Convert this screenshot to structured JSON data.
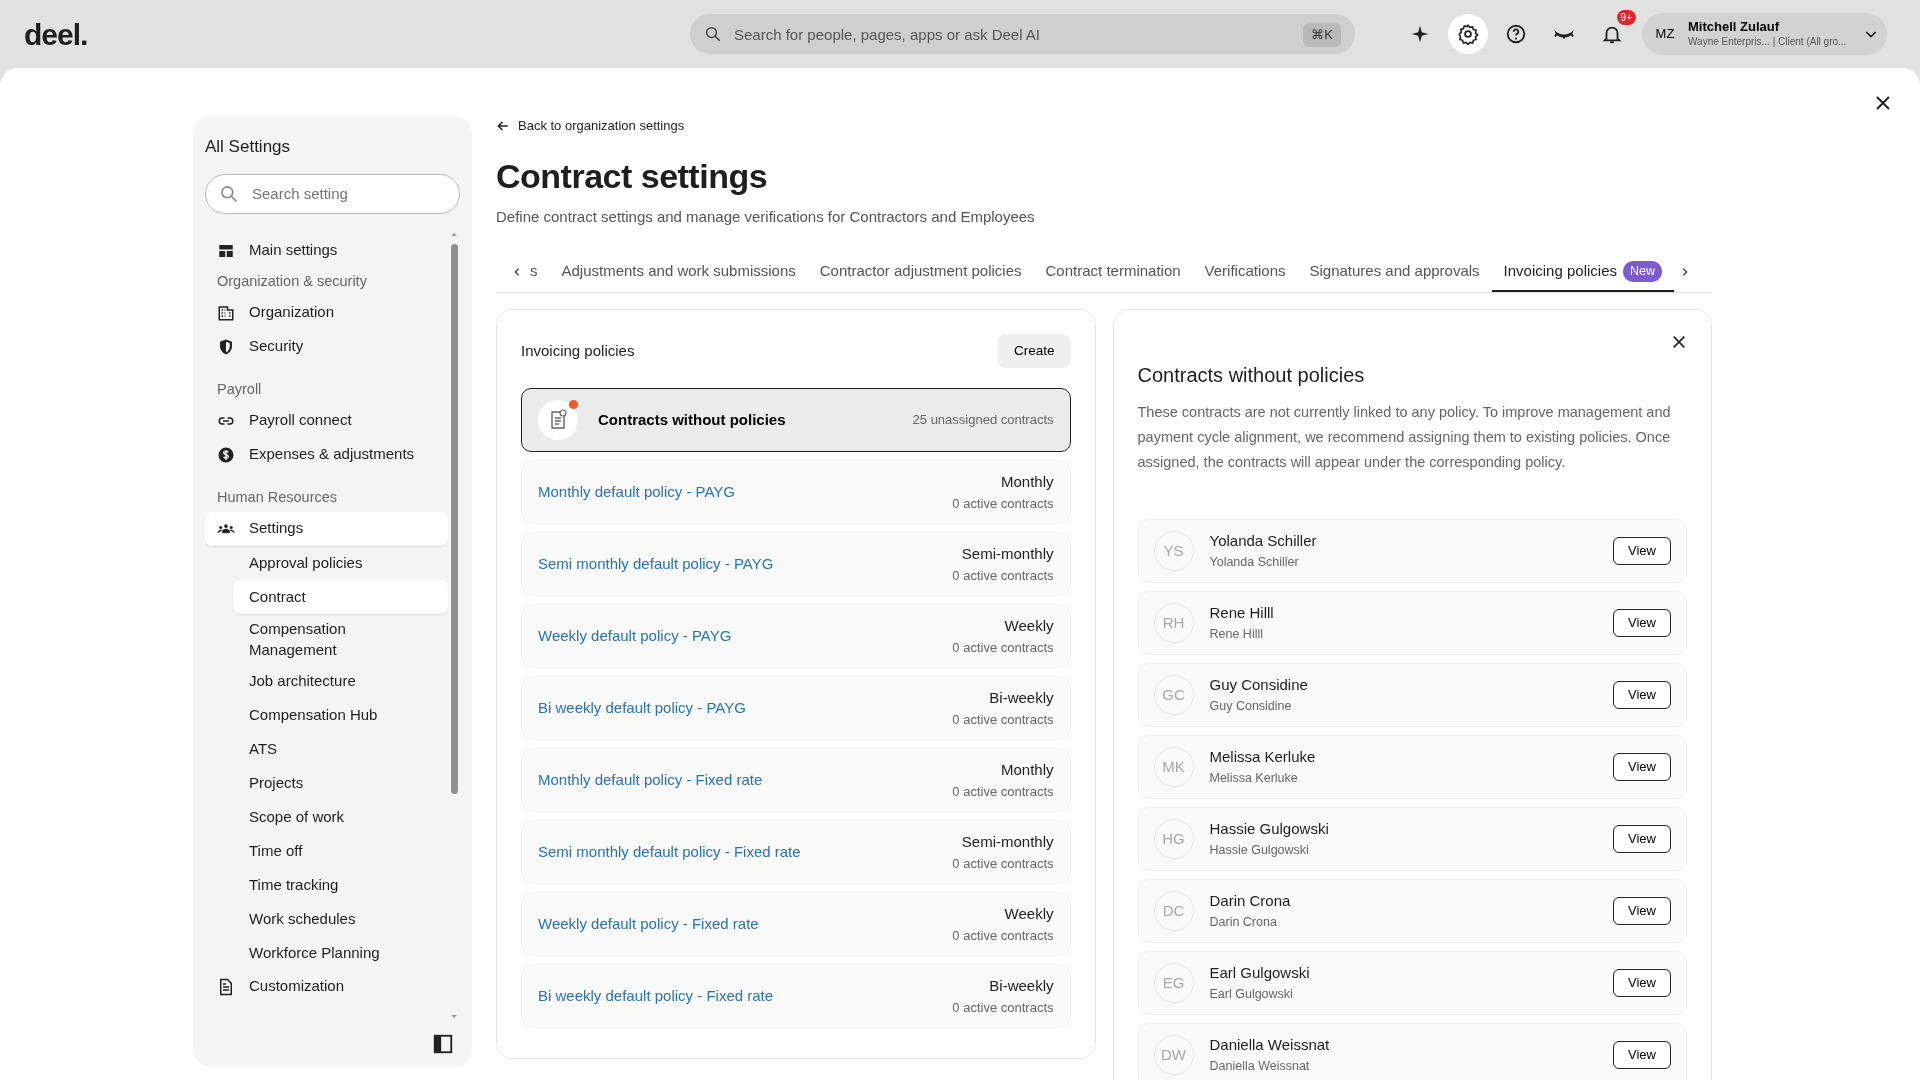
{
  "topbar": {
    "logo": "deel.",
    "search": {
      "placeholder": "Search for people, pages, apps or ask Deel AI",
      "shortcut": "⌘K"
    },
    "icon_buttons": [
      {
        "selected": false
      },
      {
        "selected": true
      },
      {
        "selected": false
      },
      {
        "selected": false
      },
      {
        "selected": false,
        "badge": "9+"
      }
    ],
    "user": {
      "initials": "MZ",
      "name": "Mitchell Zulauf",
      "detail": "Wayne Enterpris... | Client (All gro..."
    }
  },
  "sidebar": {
    "title": "All Settings",
    "search": {
      "placeholder": "Search setting"
    },
    "items": [
      {
        "kind": "link",
        "label": "Main settings",
        "selected": false
      },
      {
        "kind": "heading",
        "label": "Organization & security"
      },
      {
        "kind": "link",
        "label": "Organization",
        "selected": false
      },
      {
        "kind": "link",
        "label": "Security",
        "selected": false
      },
      {
        "kind": "heading",
        "label": "Payroll"
      },
      {
        "kind": "link",
        "label": "Payroll connect",
        "selected": false
      },
      {
        "kind": "link",
        "label": "Expenses & adjustments",
        "selected": false
      },
      {
        "kind": "heading",
        "label": "Human Resources"
      },
      {
        "kind": "link",
        "label": "Settings",
        "selected": true,
        "children": [
          {
            "label": "Approval policies",
            "selected": false
          },
          {
            "label": "Contract",
            "selected": true
          },
          {
            "label": "Compensation Management",
            "selected": false
          },
          {
            "label": "Job architecture",
            "selected": false
          },
          {
            "label": "Compensation Hub",
            "selected": false
          },
          {
            "label": "ATS",
            "selected": false
          },
          {
            "label": "Projects",
            "selected": false
          },
          {
            "label": "Scope of work",
            "selected": false
          },
          {
            "label": "Time off",
            "selected": false
          },
          {
            "label": "Time tracking",
            "selected": false
          },
          {
            "label": "Work schedules",
            "selected": false
          },
          {
            "label": "Workforce Planning",
            "selected": false
          }
        ]
      },
      {
        "kind": "link",
        "label": "Customization",
        "selected": false
      }
    ]
  },
  "back_link": "Back to organization settings",
  "title": "Contract settings",
  "subtitle": "Define contract settings and manage verifications for Contractors and Employees",
  "tabs": [
    {
      "label": "s",
      "selected": false
    },
    {
      "label": "Adjustments and work submissions",
      "selected": false
    },
    {
      "label": "Contractor adjustment policies",
      "selected": false
    },
    {
      "label": "Contract termination",
      "selected": false
    },
    {
      "label": "Verifications",
      "selected": false
    },
    {
      "label": "Signatures and approvals",
      "selected": false
    },
    {
      "label": "Invoicing policies",
      "selected": true,
      "badge": "New"
    }
  ],
  "policies_panel": {
    "title": "Invoicing policies",
    "create_button": "Create",
    "unassigned": {
      "label": "Contracts without policies",
      "count": "25 unassigned contracts",
      "selected": true
    },
    "policies": [
      {
        "name": "Monthly default policy - PAYG",
        "frequency": "Monthly",
        "count": "0 active contracts",
        "selected": false
      },
      {
        "name": "Semi monthly default policy - PAYG",
        "frequency": "Semi-monthly",
        "count": "0 active contracts",
        "selected": false
      },
      {
        "name": "Weekly default policy - PAYG",
        "frequency": "Weekly",
        "count": "0 active contracts",
        "selected": false
      },
      {
        "name": "Bi weekly default policy - PAYG",
        "frequency": "Bi-weekly",
        "count": "0 active contracts",
        "selected": false
      },
      {
        "name": "Monthly default policy - Fixed rate",
        "frequency": "Monthly",
        "count": "0 active contracts",
        "selected": false
      },
      {
        "name": "Semi monthly default policy - Fixed rate",
        "frequency": "Semi-monthly",
        "count": "0 active contracts",
        "selected": false
      },
      {
        "name": "Weekly default policy - Fixed rate",
        "frequency": "Weekly",
        "count": "0 active contracts",
        "selected": false
      },
      {
        "name": "Bi weekly default policy - Fixed rate",
        "frequency": "Bi-weekly",
        "count": "0 active contracts",
        "selected": false
      }
    ]
  },
  "detail_panel": {
    "title": "Contracts without policies",
    "description": "These contracts are not currently linked to any policy. To improve management and payment cycle alignment, we recommend assigning them to existing policies. Once assigned, the contracts will appear under the corresponding policy.",
    "contracts": [
      {
        "initials": "YS",
        "name": "Yolanda Schiller",
        "subtitle": "Yolanda Schiller",
        "action": "View"
      },
      {
        "initials": "RH",
        "name": "Rene Hilll",
        "subtitle": "Rene Hilll",
        "action": "View"
      },
      {
        "initials": "GC",
        "name": "Guy Considine",
        "subtitle": "Guy Considine",
        "action": "View"
      },
      {
        "initials": "MK",
        "name": "Melissa Kerluke",
        "subtitle": "Melissa Kerluke",
        "action": "View"
      },
      {
        "initials": "HG",
        "name": "Hassie Gulgowski",
        "subtitle": "Hassie Gulgowski",
        "action": "View"
      },
      {
        "initials": "DC",
        "name": "Darin Crona",
        "subtitle": "Darin Crona",
        "action": "View"
      },
      {
        "initials": "EG",
        "name": "Earl Gulgowski",
        "subtitle": "Earl Gulgowski",
        "action": "View"
      },
      {
        "initials": "DW",
        "name": "Daniella Weissnat",
        "subtitle": "Daniella Weissnat",
        "action": "View"
      }
    ]
  }
}
